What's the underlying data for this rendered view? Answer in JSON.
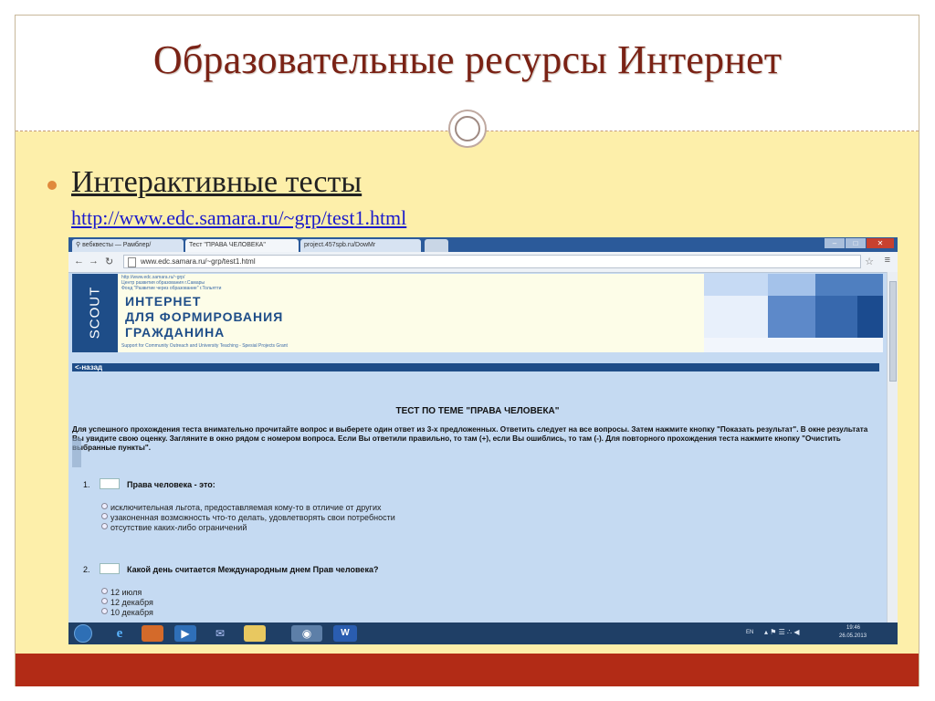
{
  "slide": {
    "title": "Образовательные ресурсы Интернет",
    "bullet_label": "Интерактивные тесты",
    "bullet_url": "http://www.edc.samara.ru/~grp/test1.html"
  },
  "browser": {
    "tabs": [
      {
        "label": "вебквесты — Рамблер/"
      },
      {
        "label": "Тест \"ПРАВА ЧЕЛОВЕКА\""
      },
      {
        "label": "project.457spb.ru/DowMr"
      }
    ],
    "address": "www.edc.samara.ru/~grp/test1.html"
  },
  "page": {
    "scout": "SCOUT",
    "small_lines": [
      "http://www.edc.samara.ru/~grp/",
      "Центр развития образования г.Самары",
      "Фонд \"Развитие через образование\" г.Тольятти"
    ],
    "banner_lines": [
      "ИНТЕРНЕТ",
      "ДЛЯ ФОРМИРОВАНИЯ",
      "ГРАЖДАНИНА"
    ],
    "banner_sub": "Support for Community Outreach and University Teaching - Spesial Projects Grant",
    "back_link": "<-назад",
    "test_title": "ТЕСТ ПО ТЕМЕ \"ПРАВА ЧЕЛОВЕКА\"",
    "instructions": "Для успешного прохождения теста внимательно прочитайте вопрос и выберете один ответ из 3-х предложенных. Ответить следует на все вопросы. Затем нажмите кнопку \"Показать результат\". В окне результата Вы увидите свою оценку. Загляните в окно рядом с номером вопроса. Если Вы ответили правильно, то там (+), если Вы ошиблись, то там (-). Для повторного прохождения теста нажмите кнопку \"Очистить выбранные пункты\".",
    "questions": [
      {
        "num": "1.",
        "text": "Права человека - это:",
        "options": [
          "исключительная льгота, предоставляемая кому-то в отличие от других",
          "узаконенная возможность что-то делать, удовлетворять свои потребности",
          "отсутствие каких-либо ограничений"
        ]
      },
      {
        "num": "2.",
        "text": "Какой день считается Международным днем Прав человека?",
        "options": [
          "12 июля",
          "12 декабря",
          "10 декабря"
        ]
      }
    ]
  },
  "taskbar": {
    "lang": "EN",
    "time": "19:46",
    "date": "26.05.2013"
  }
}
